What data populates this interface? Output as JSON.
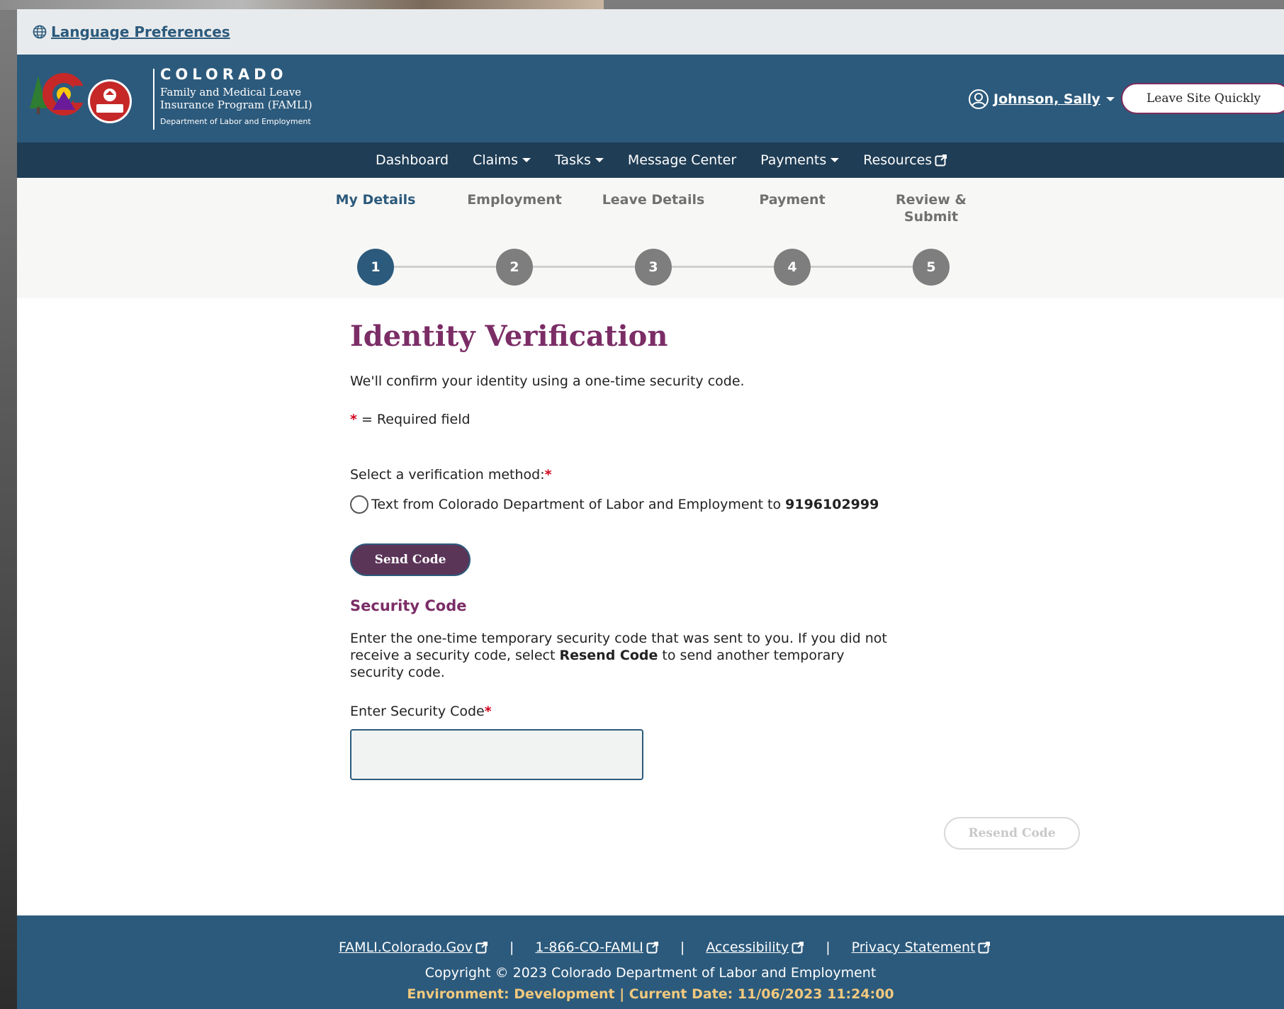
{
  "language": {
    "link_label": "Language Preferences"
  },
  "header": {
    "logo_title": "COLORADO",
    "logo_program_line1": "Family and Medical Leave",
    "logo_program_line2": "Insurance Program (FAMLI)",
    "logo_dept": "Department of Labor and Employment",
    "logo_badge": "CDLE",
    "user_name": "Johnson, Sally",
    "leave_button": "Leave Site Quickly"
  },
  "nav": {
    "items": [
      {
        "label": "Dashboard",
        "dropdown": false
      },
      {
        "label": "Claims",
        "dropdown": true
      },
      {
        "label": "Tasks",
        "dropdown": true
      },
      {
        "label": "Message Center",
        "dropdown": false
      },
      {
        "label": "Payments",
        "dropdown": true
      },
      {
        "label": "Resources",
        "dropdown": false,
        "external": true
      }
    ]
  },
  "steps": {
    "current": 1,
    "items": [
      {
        "label": "My Details",
        "number": "1"
      },
      {
        "label": "Employment",
        "number": "2"
      },
      {
        "label": "Leave Details",
        "number": "3"
      },
      {
        "label": "Payment",
        "number": "4"
      },
      {
        "label": "Review &\nSubmit",
        "number": "5"
      }
    ]
  },
  "main": {
    "title": "Identity Verification",
    "intro": "We'll confirm your identity using a one-time security code.",
    "required_star": "*",
    "required_note": " = Required field",
    "method_label": "Select a verification method:",
    "radio_text": "Text from Colorado Department of Labor and Employment to",
    "radio_phone": "9196102999",
    "send_button": "Send Code",
    "security_heading": "Security Code",
    "security_desc_part1": "Enter the one-time temporary security code that was sent to you. If you did not receive a security code, select ",
    "security_desc_bold": "Resend Code",
    "security_desc_part2": " to send another temporary security code.",
    "code_label": "Enter Security Code",
    "code_value": "",
    "resend_button": "Resend Code"
  },
  "footer": {
    "links": [
      "FAMLI.Colorado.Gov",
      "1-866-CO-FAMLI",
      "Accessibility",
      "Privacy Statement"
    ],
    "separator": "|",
    "copyright": "Copyright © 2023 Colorado Department of Labor and Employment",
    "environment": "Environment: Development | Current Date: 11/06/2023 11:24:00"
  },
  "colors": {
    "header_blue": "#2c5a7c",
    "nav_dark": "#1f3d55",
    "accent_purple": "#7b2d66",
    "send_button": "#5b3558",
    "required_red": "#d0021b",
    "env_text": "#f2c97e"
  }
}
